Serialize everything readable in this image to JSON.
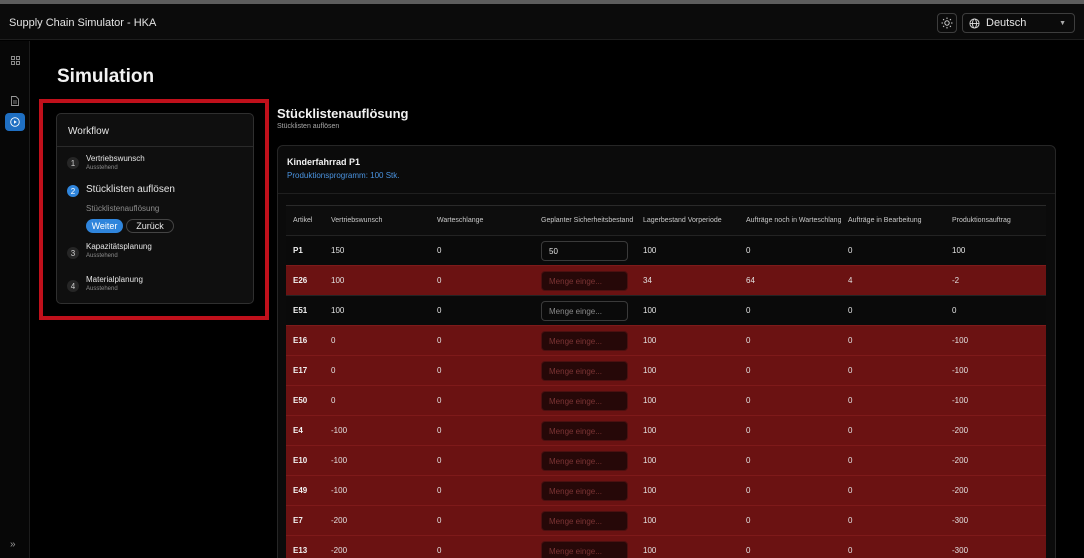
{
  "app": {
    "title": "Supply Chain Simulator - HKA"
  },
  "header": {
    "theme_icon": "sun-icon",
    "language": "Deutsch"
  },
  "rail": {
    "items": [
      "grid-icon",
      "document-icon",
      "play-circle-icon"
    ],
    "active": "play-circle-icon",
    "expand_glyph": "»"
  },
  "page": {
    "title": "Simulation"
  },
  "workflow": {
    "title": "Workflow",
    "steps": [
      {
        "num": "1",
        "title": "Vertriebswunsch",
        "status": "Ausstehend"
      },
      {
        "num": "2",
        "title": "Stücklisten auflösen",
        "substep": "Stücklistenauflösung",
        "next_label": "Weiter",
        "back_label": "Zurück"
      },
      {
        "num": "3",
        "title": "Kapazitätsplanung",
        "status": "Ausstehend"
      },
      {
        "num": "4",
        "title": "Materialplanung",
        "status": "Ausstehend"
      }
    ]
  },
  "section": {
    "title": "Stücklistenauflösung",
    "subtitle": "Stücklisten auflösen"
  },
  "card": {
    "title": "Kinderfahrrad P1",
    "subtitle": "Produktionsprogramm: 100 Stk."
  },
  "table": {
    "columns": [
      "Artikel",
      "Vertriebswunsch",
      "Warteschlange",
      "Geplanter Sicherheitsbestand",
      "Lagerbestand Vorperiode",
      "Aufträge noch in Warteschlange",
      "Aufträge in Bearbeitung",
      "Produktionsauftrag"
    ],
    "input_placeholder": "Menge einge...",
    "rows": [
      {
        "artikel": "P1",
        "vertriebswunsch": "150",
        "warteschlange": "0",
        "sicherheitsbestand": "50",
        "lagerbestand": "100",
        "wartend": "0",
        "bearbeitung": "0",
        "produktion": "100",
        "error": false
      },
      {
        "artikel": "E26",
        "vertriebswunsch": "100",
        "warteschlange": "0",
        "sicherheitsbestand": "",
        "lagerbestand": "34",
        "wartend": "64",
        "bearbeitung": "4",
        "produktion": "-2",
        "error": true
      },
      {
        "artikel": "E51",
        "vertriebswunsch": "100",
        "warteschlange": "0",
        "sicherheitsbestand": "",
        "lagerbestand": "100",
        "wartend": "0",
        "bearbeitung": "0",
        "produktion": "0",
        "error": false
      },
      {
        "artikel": "E16",
        "vertriebswunsch": "0",
        "warteschlange": "0",
        "sicherheitsbestand": "",
        "lagerbestand": "100",
        "wartend": "0",
        "bearbeitung": "0",
        "produktion": "-100",
        "error": true
      },
      {
        "artikel": "E17",
        "vertriebswunsch": "0",
        "warteschlange": "0",
        "sicherheitsbestand": "",
        "lagerbestand": "100",
        "wartend": "0",
        "bearbeitung": "0",
        "produktion": "-100",
        "error": true
      },
      {
        "artikel": "E50",
        "vertriebswunsch": "0",
        "warteschlange": "0",
        "sicherheitsbestand": "",
        "lagerbestand": "100",
        "wartend": "0",
        "bearbeitung": "0",
        "produktion": "-100",
        "error": true
      },
      {
        "artikel": "E4",
        "vertriebswunsch": "-100",
        "warteschlange": "0",
        "sicherheitsbestand": "",
        "lagerbestand": "100",
        "wartend": "0",
        "bearbeitung": "0",
        "produktion": "-200",
        "error": true
      },
      {
        "artikel": "E10",
        "vertriebswunsch": "-100",
        "warteschlange": "0",
        "sicherheitsbestand": "",
        "lagerbestand": "100",
        "wartend": "0",
        "bearbeitung": "0",
        "produktion": "-200",
        "error": true
      },
      {
        "artikel": "E49",
        "vertriebswunsch": "-100",
        "warteschlange": "0",
        "sicherheitsbestand": "",
        "lagerbestand": "100",
        "wartend": "0",
        "bearbeitung": "0",
        "produktion": "-200",
        "error": true
      },
      {
        "artikel": "E7",
        "vertriebswunsch": "-200",
        "warteschlange": "0",
        "sicherheitsbestand": "",
        "lagerbestand": "100",
        "wartend": "0",
        "bearbeitung": "0",
        "produktion": "-300",
        "error": true
      },
      {
        "artikel": "E13",
        "vertriebswunsch": "-200",
        "warteschlange": "0",
        "sicherheitsbestand": "",
        "lagerbestand": "100",
        "wartend": "0",
        "bearbeitung": "0",
        "produktion": "-300",
        "error": true
      }
    ]
  },
  "colors": {
    "accent": "#2f85dc",
    "error_row": "#6b1212",
    "highlight_border": "#c0101b"
  }
}
